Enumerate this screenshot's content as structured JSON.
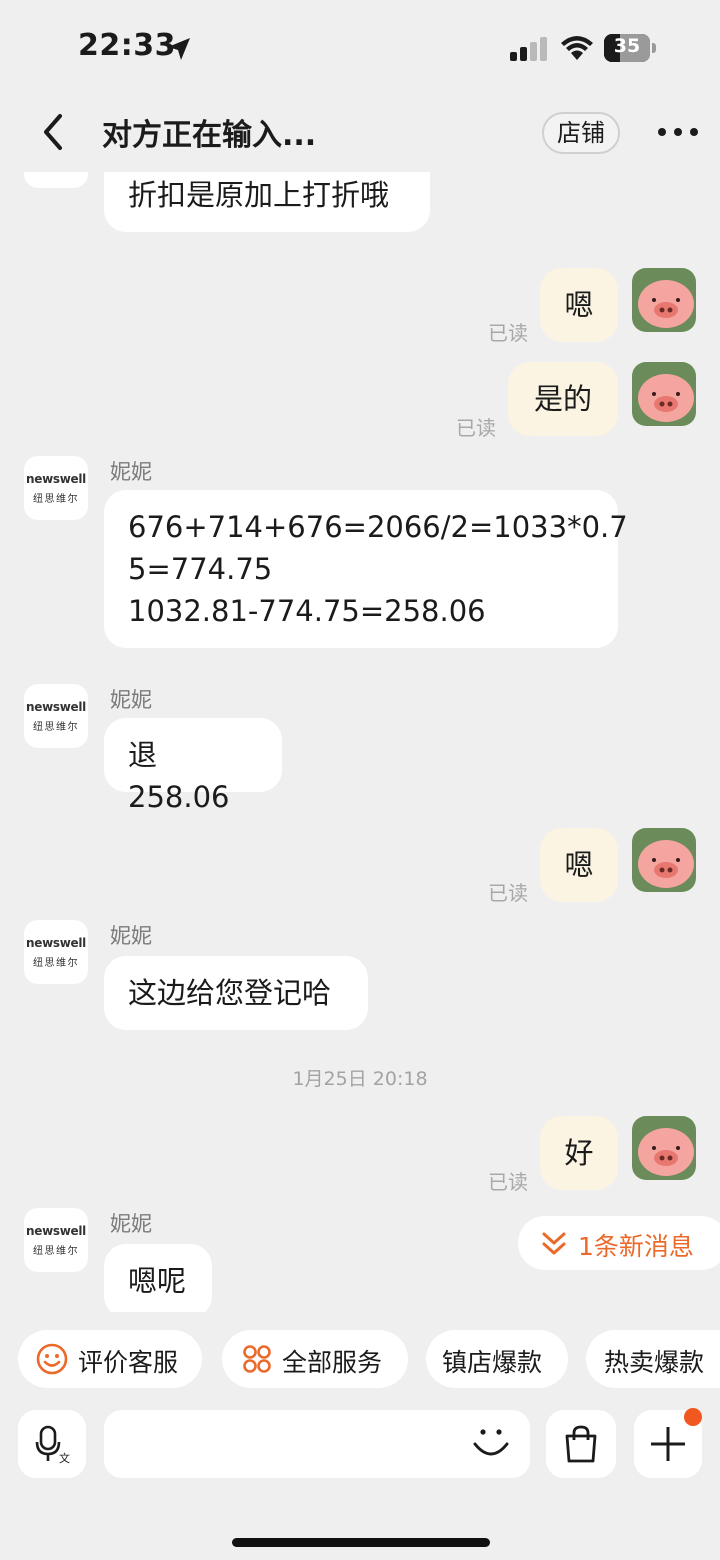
{
  "status_bar": {
    "time": "22:33",
    "battery": "35"
  },
  "header": {
    "title": "对方正在输入...",
    "store_label": "店铺"
  },
  "shop": {
    "logo_line1": "newswell",
    "logo_line2": "纽思维尔"
  },
  "messages": {
    "m0": "折扣是原加上打折哦",
    "m1": "嗯",
    "m1_read": "已读",
    "m2": "是的",
    "m2_read": "已读",
    "m3_sender": "妮妮",
    "m3_line1": "676+714+676=2066/2=1033*0.7",
    "m3_line2": "5=774.75",
    "m3_line3": "1032.81-774.75=258.06",
    "m4_sender": "妮妮",
    "m4": "退258.06",
    "m5": "嗯",
    "m5_read": "已读",
    "m6_sender": "妮妮",
    "m6": "这边给您登记哈",
    "timestamp": "1月25日 20:18",
    "m7": "好",
    "m7_read": "已读",
    "m8_sender": "妮妮",
    "m8": "嗯呢"
  },
  "new_messages": "1条新消息",
  "quick_actions": [
    "评价客服",
    "全部服务",
    "镇店爆款",
    "热卖爆款"
  ],
  "colors": {
    "accent": "#ea6a2a",
    "self_bubble": "#fbf4e3",
    "background": "#efefef"
  },
  "icons": [
    "location-arrow-icon",
    "signal-icon",
    "wifi-icon",
    "battery-icon",
    "back-icon",
    "more-icon",
    "chevron-double-down-icon",
    "smiley-icon",
    "services-icon",
    "voice-icon",
    "emoji-icon",
    "bag-icon",
    "plus-icon"
  ]
}
